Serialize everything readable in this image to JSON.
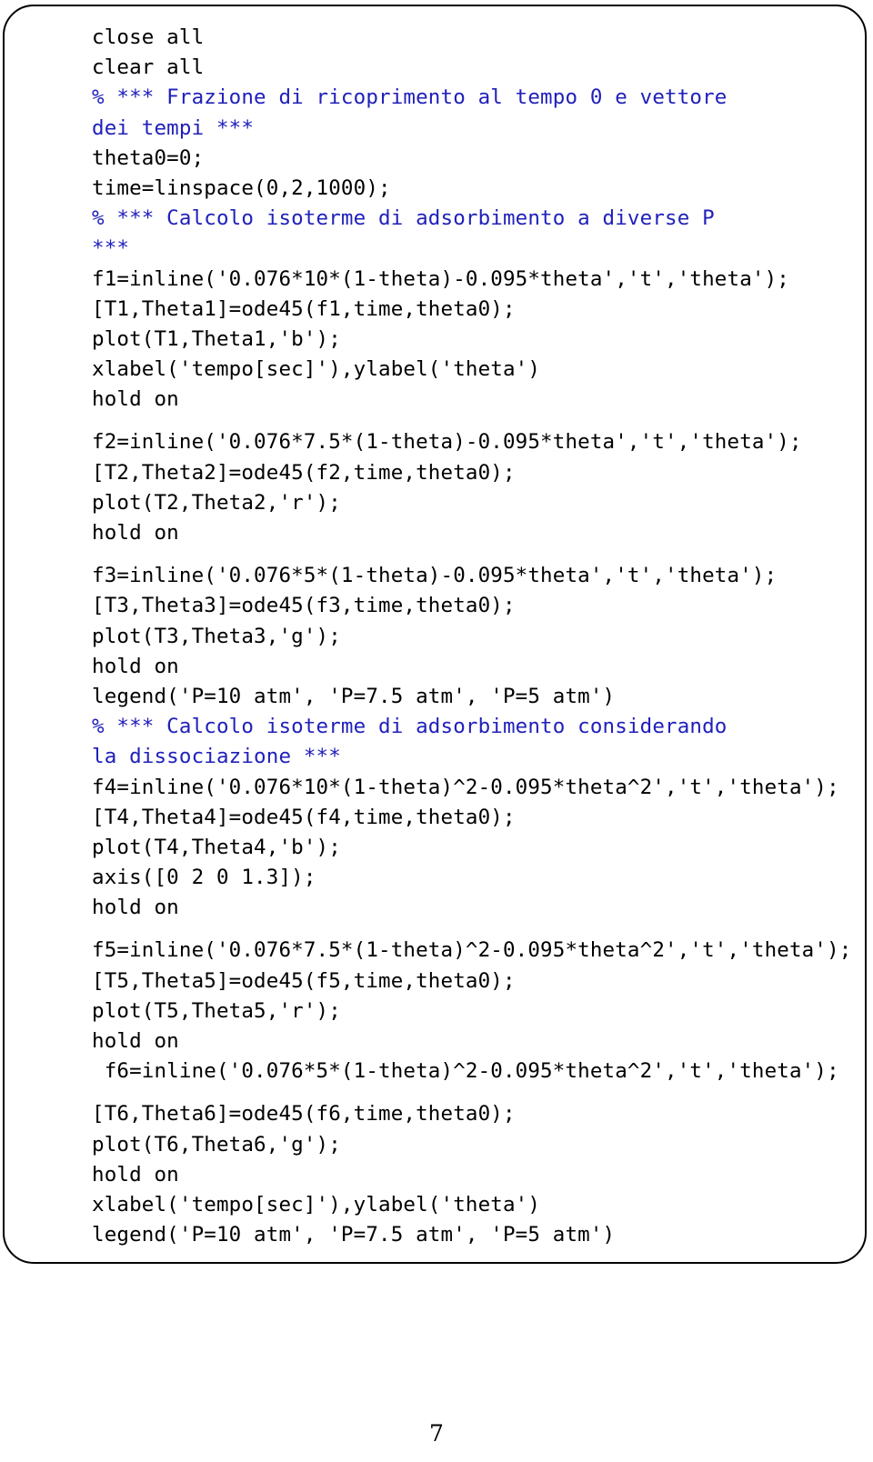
{
  "document": {
    "page_number": "7",
    "code_box": {
      "language": "matlab",
      "comment_color": "#2020bb",
      "text_color": "#000000",
      "lines": [
        {
          "text": "close all",
          "kind": "code"
        },
        {
          "text": "clear all",
          "kind": "code"
        },
        {
          "text": "% *** Frazione di ricoprimento al tempo 0 e vettore",
          "kind": "comment"
        },
        {
          "text": "dei tempi ***",
          "kind": "comment"
        },
        {
          "text": "theta0=0;",
          "kind": "code"
        },
        {
          "text": "time=linspace(0,2,1000);",
          "kind": "code"
        },
        {
          "text": "% *** Calcolo isoterme di adsorbimento a diverse P",
          "kind": "comment"
        },
        {
          "text": "***",
          "kind": "comment"
        },
        {
          "text": "f1=inline('0.076*10*(1-theta)-0.095*theta','t','theta');",
          "kind": "code"
        },
        {
          "text": "[T1,Theta1]=ode45(f1,time,theta0);",
          "kind": "code"
        },
        {
          "text": "plot(T1,Theta1,'b');",
          "kind": "code"
        },
        {
          "text": "xlabel('tempo[sec]'),ylabel('theta')",
          "kind": "code"
        },
        {
          "text": "hold on",
          "kind": "code"
        },
        {
          "text": "",
          "kind": "blank"
        },
        {
          "text": "f2=inline('0.076*7.5*(1-theta)-0.095*theta','t','theta');",
          "kind": "code"
        },
        {
          "text": "[T2,Theta2]=ode45(f2,time,theta0);",
          "kind": "code"
        },
        {
          "text": "plot(T2,Theta2,'r');",
          "kind": "code"
        },
        {
          "text": "hold on",
          "kind": "code"
        },
        {
          "text": "",
          "kind": "blank"
        },
        {
          "text": "f3=inline('0.076*5*(1-theta)-0.095*theta','t','theta');",
          "kind": "code"
        },
        {
          "text": "[T3,Theta3]=ode45(f3,time,theta0);",
          "kind": "code"
        },
        {
          "text": "plot(T3,Theta3,'g');",
          "kind": "code"
        },
        {
          "text": "hold on",
          "kind": "code"
        },
        {
          "text": "legend('P=10 atm', 'P=7.5 atm', 'P=5 atm')",
          "kind": "code"
        },
        {
          "text": "% *** Calcolo isoterme di adsorbimento considerando",
          "kind": "comment"
        },
        {
          "text": "la dissociazione ***",
          "kind": "comment"
        },
        {
          "text": "f4=inline('0.076*10*(1-theta)^2-0.095*theta^2','t','theta');",
          "kind": "code"
        },
        {
          "text": "[T4,Theta4]=ode45(f4,time,theta0);",
          "kind": "code"
        },
        {
          "text": "plot(T4,Theta4,'b');",
          "kind": "code"
        },
        {
          "text": "axis([0 2 0 1.3]);",
          "kind": "code"
        },
        {
          "text": "hold on",
          "kind": "code"
        },
        {
          "text": "",
          "kind": "blank"
        },
        {
          "text": "f5=inline('0.076*7.5*(1-theta)^2-0.095*theta^2','t','theta');",
          "kind": "code"
        },
        {
          "text": "[T5,Theta5]=ode45(f5,time,theta0);",
          "kind": "code"
        },
        {
          "text": "plot(T5,Theta5,'r');",
          "kind": "code"
        },
        {
          "text": "hold on",
          "kind": "code"
        },
        {
          "text": " f6=inline('0.076*5*(1-theta)^2-0.095*theta^2','t','theta');",
          "kind": "code"
        },
        {
          "text": "",
          "kind": "blank"
        },
        {
          "text": "[T6,Theta6]=ode45(f6,time,theta0);",
          "kind": "code"
        },
        {
          "text": "plot(T6,Theta6,'g');",
          "kind": "code"
        },
        {
          "text": "hold on",
          "kind": "code"
        },
        {
          "text": "xlabel('tempo[sec]'),ylabel('theta')",
          "kind": "code"
        },
        {
          "text": "legend('P=10 atm', 'P=7.5 atm', 'P=5 atm')",
          "kind": "code"
        }
      ]
    }
  }
}
